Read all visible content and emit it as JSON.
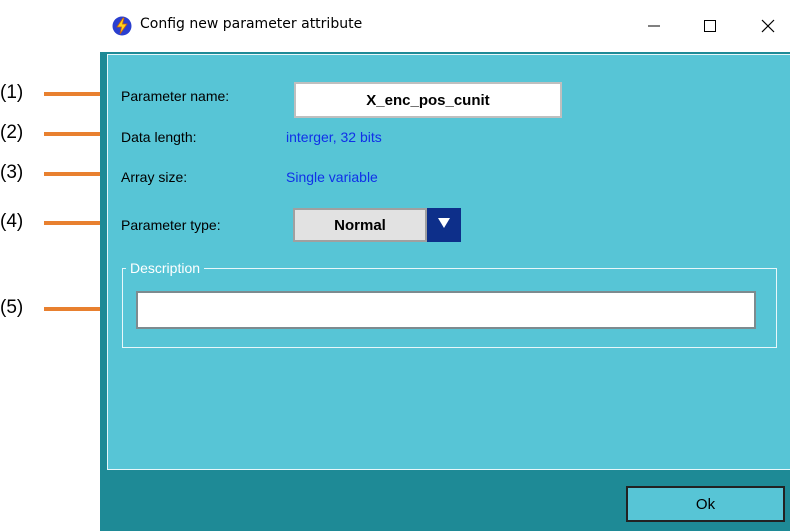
{
  "window": {
    "title": "Config new parameter attribute",
    "app_icon": "lightning-icon",
    "controls": [
      "minimize-icon",
      "maximize-icon",
      "close-icon"
    ]
  },
  "form": {
    "parameter_name_label": "Parameter name:",
    "parameter_name_value": "X_enc_pos_cunit",
    "data_length_label": "Data length:",
    "data_length_value": "interger, 32 bits",
    "array_size_label": "Array size:",
    "array_size_value": "Single variable",
    "parameter_type_label": "Parameter type:",
    "parameter_type_value": "Normal",
    "description_legend": "Description",
    "description_value": ""
  },
  "buttons": {
    "ok_label": "Ok"
  },
  "callouts": [
    "(1)",
    "(2)",
    "(3)",
    "(4)",
    "(5)"
  ],
  "colors": {
    "panel": "#57c5d6",
    "frame": "#1e8a96",
    "value_text": "#1030e8",
    "callout_line": "#e8802f",
    "dropdown_arrow": "#0d2f8a"
  }
}
